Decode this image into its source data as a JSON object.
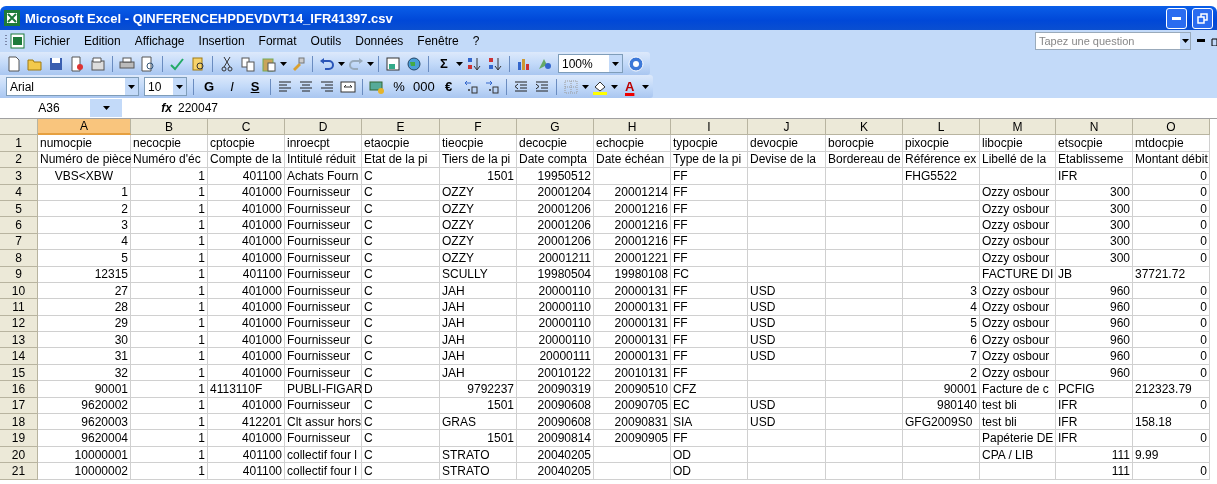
{
  "window": {
    "title": "Microsoft Excel - QINFERENCEHPDEVDVT14_IFR41397.csv"
  },
  "menu": [
    "Fichier",
    "Edition",
    "Affichage",
    "Insertion",
    "Format",
    "Outils",
    "Données",
    "Fenêtre",
    "?"
  ],
  "help_search": {
    "placeholder": "Tapez une question"
  },
  "standard_toolbar": {
    "sum_glyph": "Σ",
    "zoom": "100%"
  },
  "format_toolbar": {
    "font": "Arial",
    "size": "10",
    "style_buttons": [
      "G",
      "I",
      "S"
    ],
    "number_buttons": [
      "%",
      "000",
      "€"
    ],
    "font_color_glyph": "A"
  },
  "formula_bar": {
    "name_box": "A36",
    "function_label": "fx",
    "value": "220047"
  },
  "columns": [
    {
      "label": "A",
      "selected": true
    },
    {
      "label": "B",
      "selected": false
    },
    {
      "label": "C",
      "selected": false
    },
    {
      "label": "D",
      "selected": false
    },
    {
      "label": "E",
      "selected": false
    },
    {
      "label": "F",
      "selected": false
    },
    {
      "label": "G",
      "selected": false
    },
    {
      "label": "H",
      "selected": false
    },
    {
      "label": "I",
      "selected": false
    },
    {
      "label": "J",
      "selected": false
    },
    {
      "label": "K",
      "selected": false
    },
    {
      "label": "L",
      "selected": false
    },
    {
      "label": "M",
      "selected": false
    },
    {
      "label": "N",
      "selected": false
    },
    {
      "label": "O",
      "selected": false
    }
  ],
  "rows": [
    {
      "number": "1",
      "cells": [
        "numocpie",
        "necocpie",
        "cptocpie",
        "inroecpt",
        "etaocpie",
        "tieocpie",
        "decocpie",
        "echocpie",
        "typocpie",
        "devocpie",
        "borocpie",
        "pixocpie",
        "libocpie",
        "etsocpie",
        "mtdocpie"
      ]
    },
    {
      "number": "2",
      "cells": [
        "Numéro de pièce",
        "Numéro d'éc",
        "Compte de la",
        "Intitulé réduit",
        "Etat de la pi",
        "Tiers de la pi",
        "Date compta",
        "Date échéan",
        "Type de la pi",
        "Devise de la",
        "Bordereau de",
        "Référence ex",
        "Libellé de la",
        "Etablisseme",
        "Montant débit"
      ]
    },
    {
      "number": "3",
      "cells": [
        {
          "centered": "VBS<XBW"
        },
        {
          "number": "1"
        },
        {
          "number": "401100"
        },
        "Achats Fourn",
        "C",
        {
          "number": "1501"
        },
        {
          "number": "19950512"
        },
        null,
        "FF",
        null,
        null,
        "FHG5522",
        null,
        "IFR",
        {
          "number": "0"
        }
      ]
    },
    {
      "number": "4",
      "cells": [
        {
          "number": "1"
        },
        {
          "number": "1"
        },
        {
          "number": "401000"
        },
        "Fournisseur",
        "C",
        "OZZY",
        {
          "number": "20001204"
        },
        {
          "number": "20001214"
        },
        "FF",
        null,
        null,
        null,
        "Ozzy osbour",
        {
          "number": "300"
        },
        {
          "number": "0"
        }
      ]
    },
    {
      "number": "5",
      "cells": [
        {
          "number": "2"
        },
        {
          "number": "1"
        },
        {
          "number": "401000"
        },
        "Fournisseur",
        "C",
        "OZZY",
        {
          "number": "20001206"
        },
        {
          "number": "20001216"
        },
        "FF",
        null,
        null,
        null,
        "Ozzy osbour",
        {
          "number": "300"
        },
        {
          "number": "0"
        }
      ]
    },
    {
      "number": "6",
      "cells": [
        {
          "number": "3"
        },
        {
          "number": "1"
        },
        {
          "number": "401000"
        },
        "Fournisseur",
        "C",
        "OZZY",
        {
          "number": "20001206"
        },
        {
          "number": "20001216"
        },
        "FF",
        null,
        null,
        null,
        "Ozzy osbour",
        {
          "number": "300"
        },
        {
          "number": "0"
        }
      ]
    },
    {
      "number": "7",
      "cells": [
        {
          "number": "4"
        },
        {
          "number": "1"
        },
        {
          "number": "401000"
        },
        "Fournisseur",
        "C",
        "OZZY",
        {
          "number": "20001206"
        },
        {
          "number": "20001216"
        },
        "FF",
        null,
        null,
        null,
        "Ozzy osbour",
        {
          "number": "300"
        },
        {
          "number": "0"
        }
      ]
    },
    {
      "number": "8",
      "cells": [
        {
          "number": "5"
        },
        {
          "number": "1"
        },
        {
          "number": "401000"
        },
        "Fournisseur",
        "C",
        "OZZY",
        {
          "number": "20001211"
        },
        {
          "number": "20001221"
        },
        "FF",
        null,
        null,
        null,
        "Ozzy osbour",
        {
          "number": "300"
        },
        {
          "number": "0"
        }
      ]
    },
    {
      "number": "9",
      "cells": [
        {
          "number": "12315"
        },
        {
          "number": "1"
        },
        {
          "number": "401100"
        },
        "Fournisseur",
        "C",
        "SCULLY",
        {
          "number": "19980504"
        },
        {
          "number": "19980108"
        },
        "FC",
        null,
        null,
        null,
        "FACTURE DI",
        "JB",
        "37721.72"
      ]
    },
    {
      "number": "10",
      "cells": [
        {
          "number": "27"
        },
        {
          "number": "1"
        },
        {
          "number": "401000"
        },
        "Fournisseur",
        "C",
        "JAH",
        {
          "number": "20000110"
        },
        {
          "number": "20000131"
        },
        "FF",
        "USD",
        null,
        {
          "number": "3"
        },
        "Ozzy osbour",
        {
          "number": "960"
        },
        {
          "number": "0"
        }
      ]
    },
    {
      "number": "11",
      "cells": [
        {
          "number": "28"
        },
        {
          "number": "1"
        },
        {
          "number": "401000"
        },
        "Fournisseur",
        "C",
        "JAH",
        {
          "number": "20000110"
        },
        {
          "number": "20000131"
        },
        "FF",
        "USD",
        null,
        {
          "number": "4"
        },
        "Ozzy osbour",
        {
          "number": "960"
        },
        {
          "number": "0"
        }
      ]
    },
    {
      "number": "12",
      "cells": [
        {
          "number": "29"
        },
        {
          "number": "1"
        },
        {
          "number": "401000"
        },
        "Fournisseur",
        "C",
        "JAH",
        {
          "number": "20000110"
        },
        {
          "number": "20000131"
        },
        "FF",
        "USD",
        null,
        {
          "number": "5"
        },
        "Ozzy osbour",
        {
          "number": "960"
        },
        {
          "number": "0"
        }
      ]
    },
    {
      "number": "13",
      "cells": [
        {
          "number": "30"
        },
        {
          "number": "1"
        },
        {
          "number": "401000"
        },
        "Fournisseur",
        "C",
        "JAH",
        {
          "number": "20000110"
        },
        {
          "number": "20000131"
        },
        "FF",
        "USD",
        null,
        {
          "number": "6"
        },
        "Ozzy osbour",
        {
          "number": "960"
        },
        {
          "number": "0"
        }
      ]
    },
    {
      "number": "14",
      "cells": [
        {
          "number": "31"
        },
        {
          "number": "1"
        },
        {
          "number": "401000"
        },
        "Fournisseur",
        "C",
        "JAH",
        {
          "number": "20000111"
        },
        {
          "number": "20000131"
        },
        "FF",
        "USD",
        null,
        {
          "number": "7"
        },
        "Ozzy osbour",
        {
          "number": "960"
        },
        {
          "number": "0"
        }
      ]
    },
    {
      "number": "15",
      "cells": [
        {
          "number": "32"
        },
        {
          "number": "1"
        },
        {
          "number": "401000"
        },
        "Fournisseur",
        "C",
        "JAH",
        {
          "number": "20010122"
        },
        {
          "number": "20010131"
        },
        "FF",
        null,
        null,
        {
          "number": "2"
        },
        "Ozzy osbour",
        {
          "number": "960"
        },
        {
          "number": "0"
        }
      ]
    },
    {
      "number": "16",
      "cells": [
        {
          "number": "90001"
        },
        {
          "number": "1"
        },
        "4113110F",
        "PUBLI-FIGAR",
        "D",
        {
          "number": "9792237"
        },
        {
          "number": "20090319"
        },
        {
          "number": "20090510"
        },
        "CFZ",
        null,
        null,
        {
          "number": "90001"
        },
        "Facture de c",
        "PCFIG",
        "212323.79"
      ]
    },
    {
      "number": "17",
      "cells": [
        {
          "number": "9620002"
        },
        {
          "number": "1"
        },
        {
          "number": "401000"
        },
        "Fournisseur",
        "C",
        {
          "number": "1501"
        },
        {
          "number": "20090608"
        },
        {
          "number": "20090705"
        },
        "EC",
        "USD",
        null,
        {
          "number": "980140"
        },
        "test bli",
        "IFR",
        {
          "number": "0"
        }
      ]
    },
    {
      "number": "18",
      "cells": [
        {
          "number": "9620003"
        },
        {
          "number": "1"
        },
        {
          "number": "412201"
        },
        "Clt assur hors",
        "C",
        "GRAS",
        {
          "number": "20090608"
        },
        {
          "number": "20090831"
        },
        "SIA",
        "USD",
        null,
        "GFG2009S0",
        "test bli",
        "IFR",
        "158.18"
      ]
    },
    {
      "number": "19",
      "cells": [
        {
          "number": "9620004"
        },
        {
          "number": "1"
        },
        {
          "number": "401000"
        },
        "Fournisseur",
        "C",
        {
          "number": "1501"
        },
        {
          "number": "20090814"
        },
        {
          "number": "20090905"
        },
        "FF",
        null,
        null,
        null,
        "Papéterie DE",
        "IFR",
        {
          "number": "0"
        }
      ]
    },
    {
      "number": "20",
      "cells": [
        {
          "number": "10000001"
        },
        {
          "number": "1"
        },
        {
          "number": "401100"
        },
        "collectif four l",
        "C",
        "STRATO",
        {
          "number": "20040205"
        },
        null,
        "OD",
        null,
        null,
        null,
        "CPA / LIB",
        {
          "number": "111"
        },
        "9.99"
      ]
    },
    {
      "number": "21",
      "cells": [
        {
          "number": "10000002"
        },
        {
          "number": "1"
        },
        {
          "number": "401100"
        },
        "collectif four l",
        "C",
        "STRATO",
        {
          "number": "20040205"
        },
        null,
        "OD",
        null,
        null,
        null,
        null,
        {
          "number": "111"
        },
        {
          "number": "0"
        }
      ]
    }
  ]
}
